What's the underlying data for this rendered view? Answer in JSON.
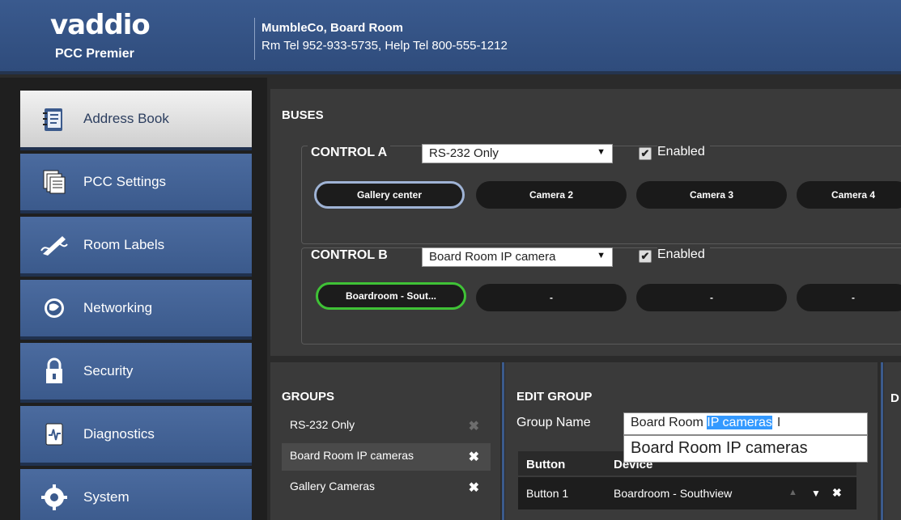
{
  "header": {
    "logo": "vaddio",
    "product": "PCC Premier",
    "site_name": "MumbleCo, Board Room",
    "site_tel": "Rm Tel 952-933-5735, Help Tel 800-555-1212"
  },
  "sidebar": {
    "items": [
      {
        "label": "Address Book",
        "icon": "address-book-icon",
        "active": true
      },
      {
        "label": "PCC Settings",
        "icon": "settings-icon"
      },
      {
        "label": "Room Labels",
        "icon": "signature-icon"
      },
      {
        "label": "Networking",
        "icon": "globe-icon"
      },
      {
        "label": "Security",
        "icon": "lock-icon"
      },
      {
        "label": "Diagnostics",
        "icon": "diagnostics-icon"
      },
      {
        "label": "System",
        "icon": "system-icon"
      }
    ]
  },
  "buses": {
    "title": "BUSES",
    "control_a": {
      "title": "CONTROL A",
      "select_value": "RS-232 Only",
      "enabled_label": "Enabled",
      "enabled": true,
      "buttons": [
        "Gallery center",
        "Camera 2",
        "Camera 3",
        "Camera 4"
      ]
    },
    "control_b": {
      "title": "CONTROL B",
      "select_value": "Board Room IP camera",
      "enabled_label": "Enabled",
      "enabled": true,
      "buttons": [
        "Boardroom - Sout...",
        "-",
        "-",
        "-"
      ]
    }
  },
  "groups": {
    "title": "GROUPS",
    "items": [
      {
        "label": "RS-232 Only",
        "deletable": false
      },
      {
        "label": "Board Room IP cameras",
        "deletable": true,
        "selected": true
      },
      {
        "label": "Gallery Cameras",
        "deletable": true
      }
    ]
  },
  "edit_group": {
    "title": "EDIT GROUP",
    "name_label": "Group Name",
    "name_value_plain": "Board Room ",
    "name_value_selected": "IP cameras",
    "autocomplete": "Board Room IP cameras",
    "columns": [
      "Button",
      "Device"
    ],
    "rows": [
      {
        "button": "Button 1",
        "device": "Boardroom - Southview"
      }
    ]
  },
  "colors": {
    "header_blue": "#3a5a8e",
    "selected_a": "#9fb3d5",
    "selected_b": "#3fc236",
    "selection_highlight": "#3399ff"
  }
}
